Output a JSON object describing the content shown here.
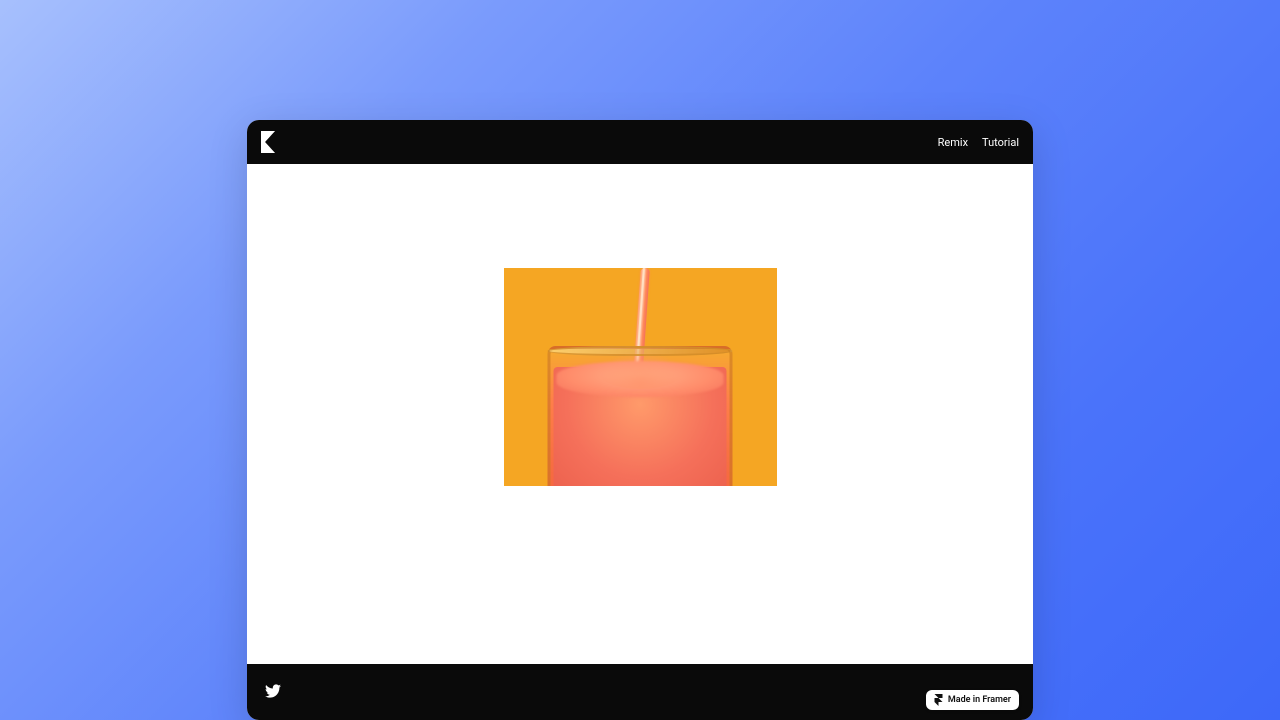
{
  "nav": {
    "items": [
      {
        "label": "Remix"
      },
      {
        "label": "Tutorial"
      }
    ]
  },
  "logo": {
    "name": "brand-logo"
  },
  "hero": {
    "alt": "Orange drink pouring into glass on yellow background"
  },
  "footer": {
    "twitter_name": "twitter-icon"
  },
  "badge": {
    "label": "Made in Framer",
    "icon_name": "framer-icon"
  }
}
